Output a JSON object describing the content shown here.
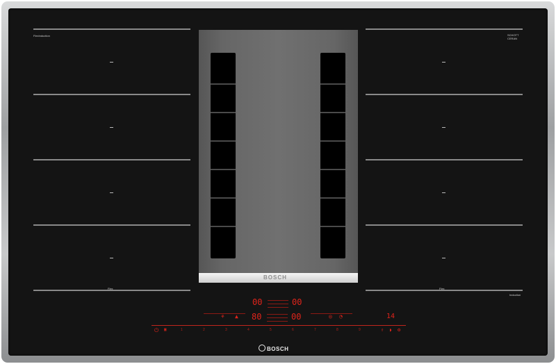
{
  "hob": {
    "vent_brand": "BOSCH",
    "bottom_brand": "BOSCH",
    "corner_left_label": "FlexInduction",
    "corner_right_label_1": "SCHOTT",
    "corner_right_label_2": "CERAN",
    "flex_left_label": "Flex",
    "flex_right_label": "Flex",
    "induction_label": "Induction"
  },
  "display": {
    "timer_left": "00",
    "timer_right": "00",
    "level_main": "80",
    "level_right": "00",
    "duration": "14",
    "scale_values": [
      "1",
      "2",
      "3",
      "4",
      "5",
      "6",
      "7",
      "8",
      "9"
    ],
    "power_icon": "power-icon"
  },
  "colors": {
    "glass": "#141414",
    "led_red": "#e0241b",
    "vent_grey": "#6a6a6a",
    "steel_frame": "#b8babc"
  }
}
